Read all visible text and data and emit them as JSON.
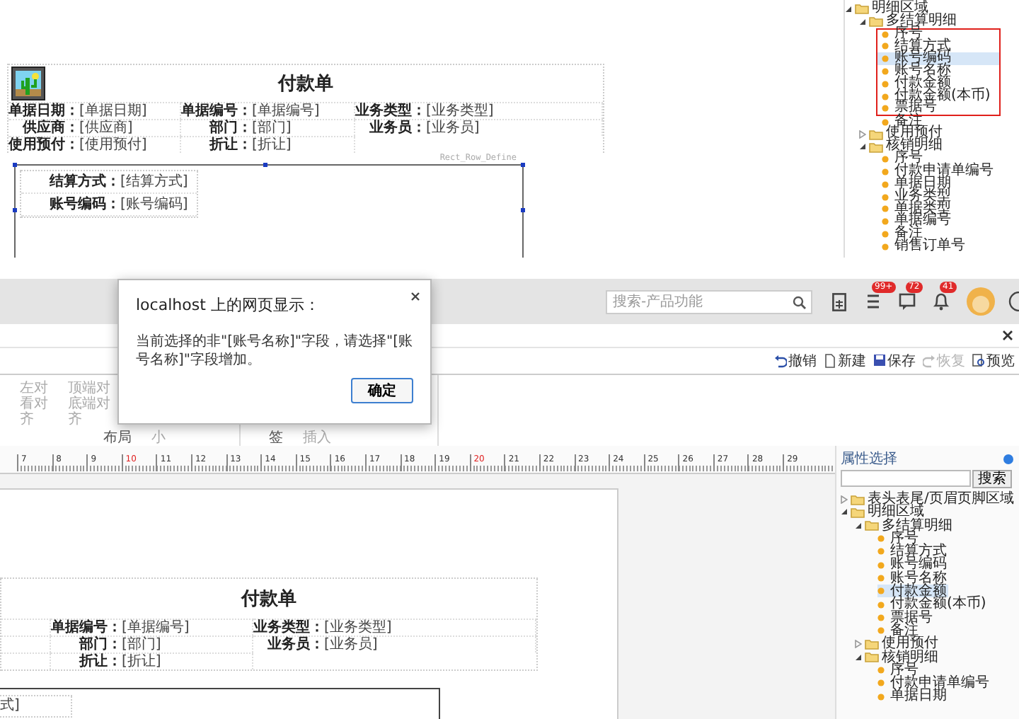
{
  "top_view": {
    "report": {
      "title": "付款单",
      "header_rows": [
        [
          {
            "label": "单据日期：",
            "value": "[单据日期]"
          },
          {
            "label": "单据编号：",
            "value": "[单据编号]"
          },
          {
            "label": "业务类型：",
            "value": "[业务类型]"
          }
        ],
        [
          {
            "label": "供应商：",
            "value": "[供应商]"
          },
          {
            "label": "部门：",
            "value": "[部门]"
          },
          {
            "label": "业务员：",
            "value": "[业务员]"
          }
        ],
        [
          {
            "label": "使用预付：",
            "value": "[使用预付]"
          },
          {
            "label": "折让：",
            "value": "[折让]"
          }
        ]
      ],
      "band_name": "Rect_Row_Define",
      "detail_rows": [
        {
          "label": "结算方式：",
          "value": "[结算方式]"
        },
        {
          "label": "账号编码：",
          "value": "[账号编码]"
        }
      ]
    },
    "tree": [
      {
        "label": "明细区域",
        "kind": "folder",
        "expanded": true,
        "children": [
          {
            "label": "多结算明细",
            "kind": "folder",
            "expanded": true,
            "children": [
              {
                "label": "序号",
                "kind": "field",
                "selected": false,
                "boxed": true
              },
              {
                "label": "结算方式",
                "kind": "field",
                "selected": false,
                "boxed": true
              },
              {
                "label": "账号编码",
                "kind": "field",
                "selected": true,
                "boxed": true
              },
              {
                "label": "账号名称",
                "kind": "field",
                "selected": false,
                "boxed": true
              },
              {
                "label": "付款金额",
                "kind": "field",
                "selected": false,
                "boxed": true
              },
              {
                "label": "付款金额(本币)",
                "kind": "field",
                "selected": false,
                "boxed": true
              },
              {
                "label": "票据号",
                "kind": "field",
                "selected": false,
                "boxed": true
              },
              {
                "label": "备注",
                "kind": "field",
                "selected": false,
                "boxed": false
              }
            ]
          },
          {
            "label": "使用预付",
            "kind": "folder",
            "expanded": false
          },
          {
            "label": "核销明细",
            "kind": "folder",
            "expanded": true,
            "children": [
              {
                "label": "序号",
                "kind": "field",
                "selected": false,
                "boxed": false
              },
              {
                "label": "付款申请单编号",
                "kind": "field",
                "selected": false,
                "boxed": false
              },
              {
                "label": "单据日期",
                "kind": "field",
                "selected": false,
                "boxed": false
              },
              {
                "label": "业务类型",
                "kind": "field",
                "selected": false,
                "boxed": false
              },
              {
                "label": "单据类型",
                "kind": "field",
                "selected": false,
                "boxed": false
              },
              {
                "label": "单据编号",
                "kind": "field",
                "selected": false,
                "boxed": false
              },
              {
                "label": "备注",
                "kind": "field",
                "selected": false,
                "boxed": false
              },
              {
                "label": "销售订单号",
                "kind": "field",
                "selected": false,
                "boxed": false
              }
            ]
          }
        ]
      }
    ]
  },
  "bottom_view": {
    "header": {
      "search": {
        "placeholder": "搜索-产品功能"
      },
      "notifications": [
        {
          "kind": "tasks",
          "badge": "99+"
        },
        {
          "kind": "messages",
          "badge": "72"
        },
        {
          "kind": "bell",
          "badge": "41"
        }
      ]
    },
    "actions": [
      {
        "label": "撤销",
        "kind": "undo",
        "disabled": false
      },
      {
        "label": "新建",
        "kind": "new",
        "disabled": false
      },
      {
        "label": "保存",
        "kind": "save",
        "disabled": false
      },
      {
        "label": "恢复",
        "kind": "redo",
        "disabled": true
      },
      {
        "label": "预览",
        "kind": "preview",
        "disabled": false
      }
    ],
    "ribbon": [
      {
        "columns": [
          [
            "左对",
            "看对",
            "齐"
          ],
          [
            "顶端对",
            "底端对",
            "齐"
          ]
        ],
        "footer": [
          "布局",
          "小"
        ]
      },
      {
        "footer": [
          "签",
          "插入"
        ]
      }
    ],
    "ruler": [
      {
        "label": "7",
        "marked": false
      },
      {
        "label": "8",
        "marked": false
      },
      {
        "label": "9",
        "marked": false
      },
      {
        "label": "10",
        "marked": true
      },
      {
        "label": "11",
        "marked": false
      },
      {
        "label": "12",
        "marked": false
      },
      {
        "label": "13",
        "marked": false
      },
      {
        "label": "14",
        "marked": false
      },
      {
        "label": "15",
        "marked": false
      },
      {
        "label": "16",
        "marked": false
      },
      {
        "label": "17",
        "marked": false
      },
      {
        "label": "18",
        "marked": false
      },
      {
        "label": "19",
        "marked": false
      },
      {
        "label": "20",
        "marked": true
      },
      {
        "label": "21",
        "marked": false
      },
      {
        "label": "22",
        "marked": false
      },
      {
        "label": "23",
        "marked": false
      },
      {
        "label": "24",
        "marked": false
      },
      {
        "label": "25",
        "marked": false
      },
      {
        "label": "26",
        "marked": false
      },
      {
        "label": "27",
        "marked": false
      },
      {
        "label": "28",
        "marked": false
      },
      {
        "label": "29",
        "marked": false
      }
    ],
    "report": {
      "title": "付款单",
      "header_rows": [
        [
          {
            "label": "单据编号：",
            "value": "[单据编号]"
          },
          {
            "label": "业务类型：",
            "value": "[业务类型]"
          }
        ],
        [
          {
            "label": "部门：",
            "value": "[部门]"
          },
          {
            "label": "业务员：",
            "value": "[业务员]"
          }
        ],
        [
          {
            "label": "折让：",
            "value": "[折让]"
          }
        ]
      ],
      "detail_fragment": "式]"
    },
    "panel": {
      "title": "属性选择",
      "search_button": "搜索",
      "tree": [
        {
          "label": "表头表尾/页眉页脚区域",
          "kind": "folder",
          "expanded": false
        },
        {
          "label": "明细区域",
          "kind": "folder",
          "expanded": true,
          "children": [
            {
              "label": "多结算明细",
              "kind": "folder",
              "expanded": true,
              "children": [
                {
                  "label": "序号",
                  "kind": "field",
                  "selected": false
                },
                {
                  "label": "结算方式",
                  "kind": "field",
                  "selected": false
                },
                {
                  "label": "账号编码",
                  "kind": "field",
                  "selected": false
                },
                {
                  "label": "账号名称",
                  "kind": "field",
                  "selected": false
                },
                {
                  "label": "付款金额",
                  "kind": "field",
                  "selected": true
                },
                {
                  "label": "付款金额(本币)",
                  "kind": "field",
                  "selected": false
                },
                {
                  "label": "票据号",
                  "kind": "field",
                  "selected": false
                },
                {
                  "label": "备注",
                  "kind": "field",
                  "selected": false
                }
              ]
            },
            {
              "label": "使用预付",
              "kind": "folder",
              "expanded": false
            },
            {
              "label": "核销明细",
              "kind": "folder",
              "expanded": true,
              "children": [
                {
                  "label": "序号",
                  "kind": "field",
                  "selected": false
                },
                {
                  "label": "付款申请单编号",
                  "kind": "field",
                  "selected": false
                },
                {
                  "label": "单据日期",
                  "kind": "field",
                  "selected": false
                }
              ]
            }
          ]
        }
      ]
    }
  },
  "dialog": {
    "title": "localhost 上的网页显示：",
    "message": "当前选择的非\"[账号名称]\"字段，请选择\"[账号名称]\"字段增加。",
    "button": "确定"
  }
}
